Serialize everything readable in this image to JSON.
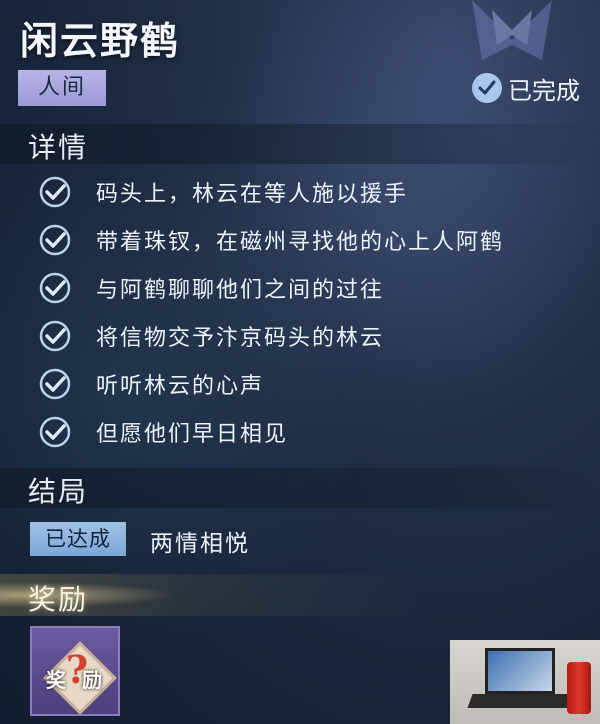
{
  "quest": {
    "title": "闲云野鹤",
    "realm_tag": "人间",
    "status_label": "已完成"
  },
  "details": {
    "heading": "详情",
    "tasks": [
      {
        "text": "码头上，林云在等人施以援手",
        "done": true
      },
      {
        "text": "带着珠钗，在磁州寻找他的心上人阿鹤",
        "done": true
      },
      {
        "text": "与阿鹤聊聊他们之间的过往",
        "done": true
      },
      {
        "text": "将信物交予汴京码头的林云",
        "done": true
      },
      {
        "text": "听听林云的心声",
        "done": true
      },
      {
        "text": "但愿他们早日相见",
        "done": true
      }
    ]
  },
  "ending": {
    "heading": "结局",
    "badge": "已达成",
    "name": "两情相悦"
  },
  "reward": {
    "heading": "奖励",
    "item": {
      "icon": "mystery-reward-icon",
      "label_left": "奖",
      "label_right": "励",
      "glyph": "?"
    }
  },
  "colors": {
    "background": "#1b2638",
    "realm_tag_bg": "#a9a6de",
    "reached_badge_bg": "#8fb3df",
    "check": "#a9c7ea",
    "reward_item_bg": "#5a4b8e"
  }
}
